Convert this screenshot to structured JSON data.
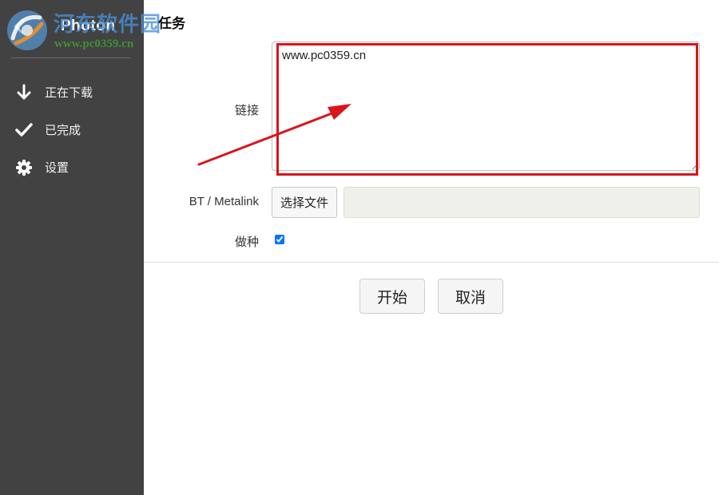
{
  "app": {
    "title": "Photon",
    "page_title": "任务"
  },
  "watermark": {
    "site_name": "河东软件园",
    "site_url": "www.pc0359.cn"
  },
  "sidebar": {
    "items": [
      {
        "label": "正在下载",
        "icon": "arrow-down-icon"
      },
      {
        "label": "已完成",
        "icon": "checkmark-icon"
      },
      {
        "label": "设置",
        "icon": "gear-icon"
      }
    ]
  },
  "form": {
    "link_label": "链接",
    "link_value": "www.pc0359.cn",
    "bt_label": "BT / Metalink",
    "choose_file_label": "选择文件",
    "file_path_value": "",
    "seed_label": "做种",
    "seed_checked": true
  },
  "actions": {
    "start_label": "开始",
    "cancel_label": "取消"
  },
  "colors": {
    "sidebar_bg": "#424242",
    "annotation_red": "#d9141a",
    "watermark_blue": "#4a8fd6",
    "watermark_green": "#3c9a34"
  }
}
